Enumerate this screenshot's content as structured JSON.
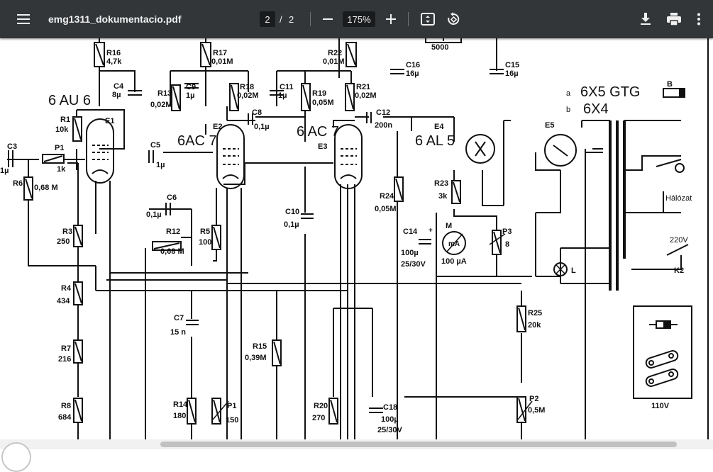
{
  "toolbar": {
    "menu_icon": "hamburger-menu-icon",
    "file_name": "emg1311_dokumentacio.pdf",
    "current_page": "2",
    "page_separator": "/",
    "total_pages": "2",
    "zoom_out_icon": "minus-icon",
    "zoom_level": "175%",
    "zoom_in_icon": "plus-icon",
    "fit_icon": "fit-to-page-icon",
    "rotate_icon": "rotate-icon",
    "download_icon": "download-icon",
    "print_icon": "print-icon",
    "more_icon": "more-vert-icon",
    "bg_color": "#323639"
  },
  "schematic": {
    "tubes": [
      "6 AU 6",
      "6AC 7",
      "6 AC 7",
      "6 AL 5",
      "6X5 GTG",
      "6X4"
    ],
    "tube_tags": [
      "E1",
      "E2",
      "E3",
      "E4",
      "E5"
    ],
    "rectifier_prefix_a": "a",
    "rectifier_prefix_b": "b",
    "labels": {
      "r16": "R16",
      "r16_val": "4,7k",
      "r17": "R17",
      "r17_val": "0,01M",
      "r22": "R22",
      "r22_val": "0,01M",
      "c_top": "5000",
      "c16": "C16",
      "c16_val": "16µ",
      "c15": "C15",
      "c15_val": "16µ",
      "c4": "C4",
      "c4_val": "8µ",
      "r13": "R13",
      "r13_val": "0,02M",
      "c9": "C9",
      "c9_val": "1µ",
      "r18": "R18",
      "r18_val": "0,02M",
      "c11": "C11",
      "c11_val": "1µ",
      "r19": "R19",
      "r19_val": "0,05M",
      "r21": "R21",
      "r21_val": "0,02M",
      "r1": "R1",
      "r1_val": "10k",
      "c8": "C8",
      "c8_val": "0,1µ",
      "c12": "C12",
      "c12_val": "200n",
      "c3": "C3",
      "c3_val": "1µ",
      "p1": "P1",
      "p1_val": "1k",
      "c5": "C5",
      "c5_val": "1µ",
      "r6": "R6",
      "r6_val": "0,68 M",
      "c6": "C6",
      "c6_val": "0,1µ",
      "r3": "R3",
      "r3_val": "250",
      "r12": "R12",
      "r12_val": "0,68 M",
      "r5": "R5",
      "r5_val": "100",
      "c10": "C10",
      "c10_val": "0,1µ",
      "r24": "R24",
      "r24_val": "0,05M",
      "r23": "R23",
      "r23_val": "3k",
      "c14": "C14",
      "c14_val": "100µ",
      "c14_v": "25/30V",
      "meter": "M",
      "meter_unit": "mA",
      "meter_val": "100 µA",
      "p3": "P3",
      "p3_val": "8",
      "lamp": "L",
      "r4": "R4",
      "r4_val": "434",
      "r7": "R7",
      "r7_val": "216",
      "r8": "R8",
      "r8_val": "684",
      "c7": "C7",
      "c7_val": "15 n",
      "r15": "R15",
      "r15_val": "0,39M",
      "r25": "R25",
      "r25_val": "20k",
      "r14": "R14",
      "r14_val": "180",
      "p1b": "P1",
      "p1b_val": "150",
      "r20": "R20",
      "r20_val": "270",
      "c18": "C18",
      "c18_val": "100µ",
      "c18_v": "25/30V",
      "p2": "P2",
      "p2_val": "0,5M",
      "mains": "Hálózat",
      "voltage": "220V",
      "switch": "K2",
      "fuse": "B",
      "sel_voltage": "110V"
    }
  }
}
